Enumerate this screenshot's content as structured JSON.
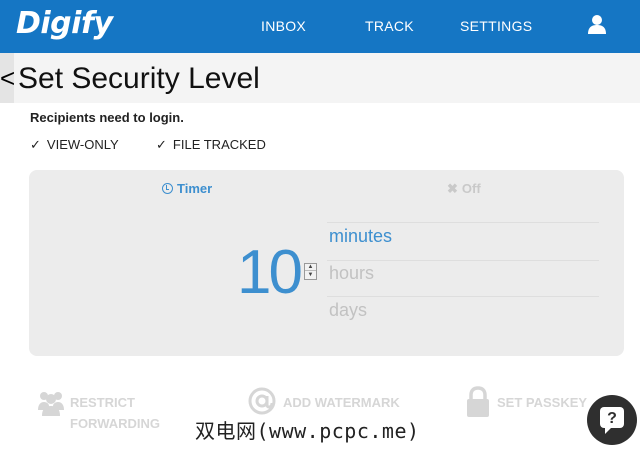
{
  "app": {
    "logo": "Digify"
  },
  "nav": {
    "items": [
      {
        "label": "INBOX"
      },
      {
        "label": "TRACK"
      },
      {
        "label": "SETTINGS"
      }
    ],
    "user_icon": "user-icon"
  },
  "header": {
    "back_label": "<",
    "title": "Set Security Level"
  },
  "login_note": "Recipients need to login.",
  "options": [
    {
      "label": "VIEW-ONLY",
      "checked": true
    },
    {
      "label": "FILE TRACKED",
      "checked": true
    }
  ],
  "timer_panel": {
    "tabs": [
      {
        "label": "Timer",
        "icon": "clock-icon",
        "active": true
      },
      {
        "label": "Off",
        "icon": "x-icon",
        "active": false
      }
    ],
    "value": "10",
    "units": [
      {
        "label": "minutes",
        "selected": true
      },
      {
        "label": "hours",
        "selected": false
      },
      {
        "label": "days",
        "selected": false
      }
    ]
  },
  "features": [
    {
      "label_line1": "RESTRICT",
      "label_line2": "FORWARDING",
      "icon": "users-icon"
    },
    {
      "label_line1": "ADD WATERMARK",
      "label_line2": "",
      "icon": "at-icon"
    },
    {
      "label_line1": "SET PASSKEY",
      "label_line2": "",
      "icon": "lock-icon"
    }
  ],
  "overlay_watermark": "双电网(www.pcpc.me)",
  "chat": {
    "icon": "chat-help-icon",
    "label": "?"
  },
  "colors": {
    "brand": "#1576c4",
    "accent": "#3d8fcf",
    "panel_bg": "#ececec",
    "disabled": "#c2c2c2"
  }
}
